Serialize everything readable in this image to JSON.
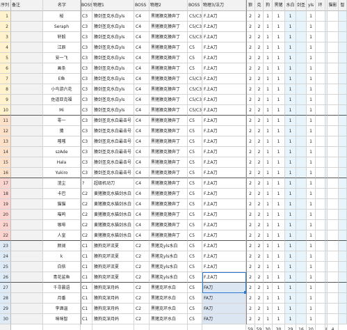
{
  "headers": [
    "序列",
    "备注",
    "名字",
    "BOSS",
    "物理1",
    "BOSS",
    "物理2",
    "BOSS",
    "物理3/法刀",
    "狼",
    "克",
    "狗",
    "黑猪",
    "水白",
    "剑圣",
    "yls",
    "环",
    "",
    "猫影",
    "智"
  ],
  "rows": [
    {
      "num": "1",
      "name": "桜",
      "b1": "C3",
      "p1": "猿剑圣克水白yls",
      "b2": "C4",
      "p2": "黑猪猿克猿奔丁",
      "b3": "C5/C3",
      "p3": "F上A刀",
      "v": [
        "2",
        "2",
        "1",
        "1",
        "1",
        "",
        "1"
      ]
    },
    {
      "num": "2",
      "name": "Seraph",
      "b1": "C3",
      "p1": "猿剑圣克水白yls",
      "b2": "C4",
      "p2": "黑猪猿克猿奔丁",
      "b3": "C5/C3",
      "p3": "F上A刀",
      "v": [
        "2",
        "2",
        "1",
        "1",
        "1",
        "",
        "1"
      ]
    },
    {
      "num": "3",
      "name": "轩毅",
      "b1": "C3",
      "p1": "猿剑圣克水白yls",
      "b2": "C4",
      "p2": "黑猪猿克猿奔丁",
      "b3": "C5/C3",
      "p3": "F上A刀",
      "v": [
        "2",
        "2",
        "1",
        "1",
        "1",
        "",
        "1"
      ]
    },
    {
      "num": "4",
      "name": "江辰",
      "b1": "C3",
      "p1": "猿剑圣克水白yls",
      "b2": "C4",
      "p2": "黑猪猿克猿奔丁",
      "b3": "C5",
      "p3": "F上A刀",
      "v": [
        "2",
        "2",
        "1",
        "1",
        "1",
        "",
        "1"
      ]
    },
    {
      "num": "5",
      "name": "安一飞",
      "b1": "C3",
      "p1": "猿剑圣克水白yls",
      "b2": "C4",
      "p2": "黑猪猿克猿奔丁",
      "b3": "C5",
      "p3": "F上A刀",
      "v": [
        "2",
        "2",
        "1",
        "1",
        "1",
        "",
        "1"
      ]
    },
    {
      "num": "6",
      "name": "画条",
      "b1": "C3",
      "p1": "猿剑圣克水白yls",
      "b2": "C4",
      "p2": "黑猪猿克猿奔丁",
      "b3": "C5",
      "p3": "F上A刀",
      "v": [
        "2",
        "2",
        "1",
        "1",
        "1",
        "",
        "1"
      ]
    },
    {
      "num": "7",
      "name": "E鱼",
      "b1": "C3",
      "p1": "猿剑圣克水白yls",
      "b2": "C4",
      "p2": "黑猪猿克猿奔丁",
      "b3": "C5/C3",
      "p3": "F上A刀",
      "v": [
        "2",
        "2",
        "1",
        "1",
        "1",
        "",
        "1"
      ]
    },
    {
      "num": "8",
      "name": "小鸟游六花",
      "b1": "C3",
      "p1": "猿剑圣克水白yls",
      "b2": "C4",
      "p2": "黑猪猿克猿奔丁",
      "b3": "C5/C3",
      "p3": "F上A刀",
      "v": [
        "2",
        "2",
        "1",
        "1",
        "1",
        "",
        "1"
      ]
    },
    {
      "num": "9",
      "name": "佐道亚克福",
      "b1": "C3",
      "p1": "猿剑圣克水白yls",
      "b2": "C4",
      "p2": "黑猪猿克猿奔丁",
      "b3": "C5/C3",
      "p3": "F上A刀",
      "v": [
        "2",
        "2",
        "1",
        "1",
        "1",
        "",
        "1"
      ]
    },
    {
      "num": "10",
      "name": "Mi",
      "b1": "C3",
      "p1": "猿剑圣克水白yls",
      "b2": "C4",
      "p2": "黑猪猿克猿奔丁",
      "b3": "C5/C3",
      "p3": "F上A刀",
      "v": [
        "2",
        "2",
        "1",
        "1",
        "1",
        "",
        "1"
      ]
    },
    {
      "num": "11",
      "name": "零一",
      "b1": "C3",
      "p1": "猿剑圣克水白最击号",
      "b2": "C4",
      "p2": "黑猪猿克猿奔丁",
      "b3": "C5",
      "p3": "F上A刀",
      "v": [
        "2",
        "2",
        "1",
        "1",
        "1",
        "",
        "1"
      ]
    },
    {
      "num": "12",
      "name": "猜",
      "b1": "C3",
      "p1": "猿剑圣克水白最击号",
      "b2": "C4",
      "p2": "黑猪猿克猿奔丁",
      "b3": "C5",
      "p3": "F上A刀",
      "v": [
        "2",
        "2",
        "1",
        "1",
        "1",
        "",
        "1"
      ]
    },
    {
      "num": "13",
      "name": "嗤嗤",
      "b1": "C3",
      "p1": "猿剑圣克水白最击号",
      "b2": "C4",
      "p2": "黑猪猿克猿奔丁",
      "b3": "C5",
      "p3": "F上A刀",
      "v": [
        "2",
        "2",
        "1",
        "1",
        "1",
        "",
        "1"
      ]
    },
    {
      "num": "14",
      "name": "szAde",
      "b1": "C3",
      "p1": "猿剑圣克水白最击号",
      "b2": "C4",
      "p2": "黑猪猿克猿奔丁",
      "b3": "C5",
      "p3": "F上A刀",
      "v": [
        "2",
        "2",
        "1",
        "1",
        "1",
        "",
        "1"
      ]
    },
    {
      "num": "15",
      "name": "Hala",
      "b1": "C3",
      "p1": "猿剑圣克水白最击号",
      "b2": "C4",
      "p2": "黑猪猿克猿奔丁",
      "b3": "C5",
      "p3": "F上A刀",
      "v": [
        "2",
        "2",
        "1",
        "1",
        "1",
        "",
        "1"
      ]
    },
    {
      "num": "16",
      "name": "Yukiro",
      "b1": "C3",
      "p1": "猿剑圣克水白最击号",
      "b2": "C4",
      "p2": "黑猪猿克猿奔丁",
      "b3": "C5",
      "p3": "F上A刀",
      "v": [
        "2",
        "2",
        "1",
        "1",
        "1",
        "",
        "1"
      ]
    },
    {
      "num": "17",
      "name": "渣尘",
      "b1": "?",
      "p1": "超级机动刀",
      "b2": "C4",
      "p2": "黑猪猿克猿奔丁",
      "b3": "C5",
      "p3": "F上A刀",
      "v": [
        "2",
        "2",
        "1",
        "1",
        "1",
        "",
        "1"
      ]
    },
    {
      "num": "18",
      "name": "卡巴",
      "b1": "C2",
      "p1": "黄猪猿克水猫剑水白",
      "b2": "C4",
      "p2": "黑猪猿克猿奔丁",
      "b3": "C5",
      "p3": "F上A刀",
      "v": [
        "2",
        "2",
        "1",
        "1",
        "1",
        "",
        "1"
      ]
    },
    {
      "num": "19",
      "name": "猫猫",
      "b1": "C2",
      "p1": "黄猪猿克水猫剑水白",
      "b2": "C4",
      "p2": "黑猪猿克猿奔丁",
      "b3": "C5",
      "p3": "F上A刀",
      "v": [
        "2",
        "2",
        "1",
        "1",
        "1",
        "",
        "1"
      ]
    },
    {
      "num": "20",
      "name": "喵呜",
      "b1": "C2",
      "p1": "黄猪猿克水猫剑水白",
      "b2": "C4",
      "p2": "黑猪猿克猿奔丁",
      "b3": "C5",
      "p3": "F上A刀",
      "v": [
        "2",
        "2",
        "1",
        "1",
        "1",
        "",
        "1"
      ]
    },
    {
      "num": "21",
      "name": "咖啡",
      "b1": "C2",
      "p1": "黄猪猿克水猫剑水白",
      "b2": "C4",
      "p2": "黑猪猿克猿奔丁",
      "b3": "C5",
      "p3": "F上A刀",
      "v": [
        "2",
        "2",
        "1",
        "1",
        "1",
        "",
        "1"
      ]
    },
    {
      "num": "22",
      "name": "人皇",
      "b1": "C2",
      "p1": "黄猪猿克水猫剑水白",
      "b2": "C4",
      "p2": "黑猪猿克猿奔丁",
      "b3": "C5",
      "p3": "F上A刀",
      "v": [
        "2",
        "2",
        "1",
        "1",
        "1",
        "",
        "1"
      ]
    },
    {
      "num": "23",
      "name": "颜阔",
      "b1": "C1",
      "p1": "猿狗克环流夏",
      "b2": "C2",
      "p2": "黑猪克yls水白",
      "b3": "C5",
      "p3": "F上A刀",
      "v": [
        "2",
        "2",
        "1",
        "1",
        "1",
        "",
        "1"
      ]
    },
    {
      "num": "24",
      "name": "k",
      "b1": "C1",
      "p1": "猿狗克环流夏",
      "b2": "C2",
      "p2": "黑猪克yls水白",
      "b3": "C5",
      "p3": "F上A刀",
      "v": [
        "2",
        "2",
        "1",
        "1",
        "1",
        "",
        "1"
      ]
    },
    {
      "num": "25",
      "name": "白依",
      "b1": "C1",
      "p1": "猿狗克环流夏",
      "b2": "C2",
      "p2": "黑猪克yls水白",
      "b3": "C5",
      "p3": "F上A刀",
      "v": [
        "2",
        "2",
        "1",
        "1",
        "1",
        "",
        "1"
      ]
    },
    {
      "num": "26",
      "name": "青花鲨鱼",
      "b1": "C1",
      "p1": "猿狗克环流夏",
      "b2": "C2",
      "p2": "黑猪克yls水白",
      "b3": "C5",
      "p3": "F上A刀",
      "v": [
        "2",
        "2",
        "1",
        "1",
        "1",
        "",
        "1"
      ]
    },
    {
      "num": "27",
      "name": "千寻晨语",
      "b1": "C1",
      "p1": "猿狗克深月妈",
      "b2": "C2",
      "p2": "黑猪克环水白",
      "b3": "C5",
      "p3": "FA刀",
      "v": [
        "2",
        "2",
        "1",
        "1",
        "1",
        "",
        "1"
      ]
    },
    {
      "num": "28",
      "name": "月番",
      "b1": "C1",
      "p1": "猿狗克深月妈",
      "b2": "C2",
      "p2": "黑猪克环水白",
      "b3": "C5",
      "p3": "FA刀",
      "v": [
        "2",
        "2",
        "1",
        "1",
        "1",
        "",
        "1"
      ]
    },
    {
      "num": "29",
      "name": "李酒温",
      "b1": "C1",
      "p1": "猿狗克深月妈",
      "b2": "C2",
      "p2": "黑猪克环水白",
      "b3": "C5",
      "p3": "FA刀",
      "v": [
        "2",
        "2",
        "1",
        "1",
        "1",
        "",
        "1"
      ]
    },
    {
      "num": "30",
      "name": "咪咪智",
      "b1": "C1",
      "p1": "猿狗克深月妈",
      "b2": "C2",
      "p2": "黑猪克环水白",
      "b3": "C5",
      "p3": "FA刀",
      "v": [
        "2",
        "2",
        "1",
        "1",
        "1",
        "",
        "1"
      ]
    }
  ],
  "totals": [
    "59",
    "59",
    "30",
    "30",
    "29",
    "16",
    "20",
    "",
    "8",
    "4"
  ],
  "colors": {
    "row_yellow": "#fff2cc",
    "row_orange": "#fde0c8",
    "row_red": "#fbd3cf",
    "row_blue": "#deebf7",
    "light_blue": "#e8f4fb",
    "selection": "#2b79d0"
  }
}
